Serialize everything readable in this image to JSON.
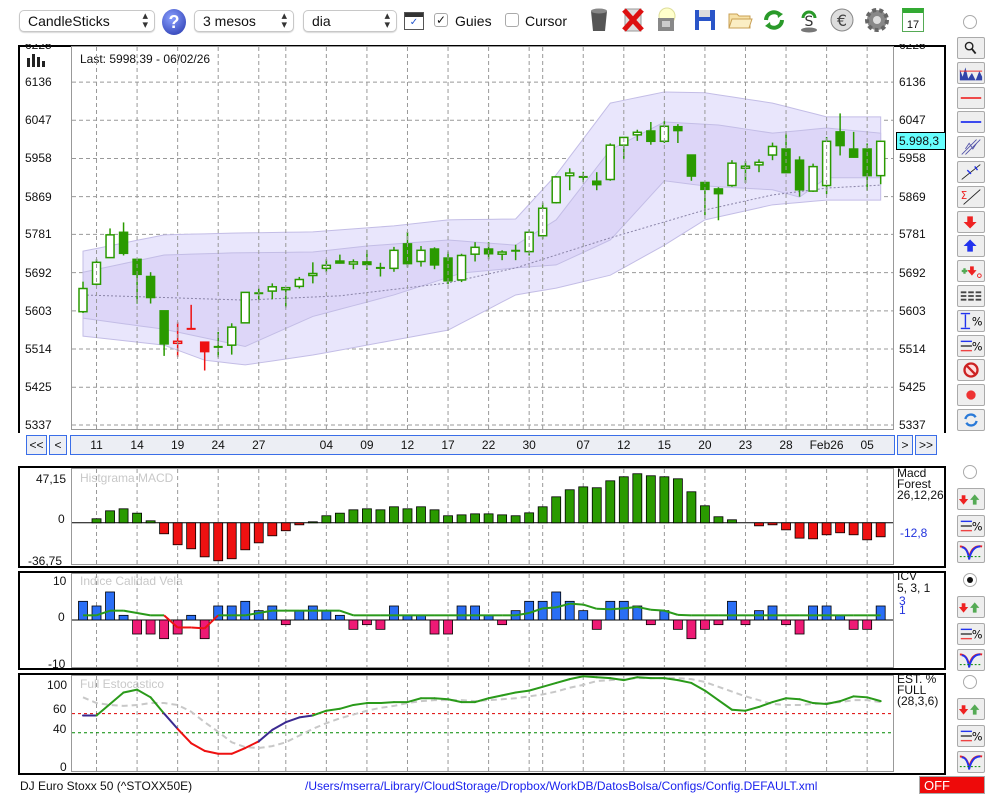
{
  "toolbar": {
    "chart_type": "CandleSticks",
    "period": "3 mesos",
    "interval": "dia",
    "guides_label": "Guies",
    "guides_checked": true,
    "cursor_label": "Cursor",
    "cursor_checked": false,
    "help_icon": "?",
    "calendar_day": "17"
  },
  "main": {
    "last_label": "Last: 5998.39 - 06/02/26",
    "current_price_badge": "5.998,3",
    "badge_color": "#66ffff",
    "y_ticks": [
      "6225",
      "6136",
      "6047",
      "5958",
      "5869",
      "5781",
      "5692",
      "5603",
      "5514",
      "5425",
      "5337"
    ],
    "x_labels": [
      {
        "t": "11",
        "i": 2
      },
      {
        "t": "14",
        "i": 5
      },
      {
        "t": "19",
        "i": 8
      },
      {
        "t": "24",
        "i": 11
      },
      {
        "t": "27",
        "i": 14
      },
      {
        "t": "04",
        "i": 19
      },
      {
        "t": "09",
        "i": 22
      },
      {
        "t": "12",
        "i": 25
      },
      {
        "t": "17",
        "i": 28
      },
      {
        "t": "22",
        "i": 31
      },
      {
        "t": "30",
        "i": 34
      },
      {
        "t": "07",
        "i": 38
      },
      {
        "t": "12",
        "i": 41
      },
      {
        "t": "15",
        "i": 44
      },
      {
        "t": "20",
        "i": 47
      },
      {
        "t": "23",
        "i": 50
      },
      {
        "t": "28",
        "i": 53
      },
      {
        "t": "Feb26",
        "i": 56
      },
      {
        "t": "05",
        "i": 59
      }
    ],
    "grid_candles": [
      2,
      5,
      8,
      11,
      14,
      16,
      19,
      22,
      25,
      28,
      31,
      34,
      35,
      38,
      41,
      44,
      47,
      50,
      53,
      56,
      59
    ],
    "nav": {
      "first": "<<",
      "prev": "<",
      "next": ">",
      "last": ">>"
    }
  },
  "chart_data": [
    {
      "type": "candlestick",
      "title": "DJ Euro Stoxx 50",
      "ylim": [
        5337,
        6225
      ],
      "ohlc": [
        [
          5601,
          5671,
          5598,
          5655
        ],
        [
          5665,
          5723,
          5662,
          5716
        ],
        [
          5727,
          5795,
          5726,
          5780
        ],
        [
          5786,
          5809,
          5732,
          5737
        ],
        [
          5723,
          5723,
          5620,
          5688
        ],
        [
          5683,
          5693,
          5620,
          5634
        ],
        [
          5603,
          5603,
          5498,
          5526
        ],
        [
          5528,
          5576,
          5496,
          5532
        ],
        [
          5561,
          5617,
          5561,
          5561
        ],
        [
          5530,
          5530,
          5464,
          5508
        ],
        [
          5519,
          5554,
          5495,
          5520
        ],
        [
          5523,
          5574,
          5501,
          5565
        ],
        [
          5575,
          5646,
          5575,
          5646
        ],
        [
          5644,
          5655,
          5628,
          5644
        ],
        [
          5649,
          5667,
          5630,
          5659
        ],
        [
          5653,
          5657,
          5611,
          5657
        ],
        [
          5660,
          5682,
          5655,
          5676
        ],
        [
          5688,
          5716,
          5667,
          5690
        ],
        [
          5702,
          5723,
          5693,
          5709
        ],
        [
          5719,
          5734,
          5713,
          5716
        ],
        [
          5712,
          5723,
          5700,
          5717
        ],
        [
          5717,
          5745,
          5698,
          5711
        ],
        [
          5703,
          5715,
          5683,
          5704
        ],
        [
          5702,
          5752,
          5694,
          5744
        ],
        [
          5759,
          5787,
          5704,
          5713
        ],
        [
          5718,
          5754,
          5706,
          5744
        ],
        [
          5747,
          5751,
          5700,
          5710
        ],
        [
          5726,
          5741,
          5665,
          5673
        ],
        [
          5675,
          5736,
          5670,
          5732
        ],
        [
          5735,
          5763,
          5718,
          5751
        ],
        [
          5747,
          5763,
          5723,
          5736
        ],
        [
          5735,
          5744,
          5721,
          5740
        ],
        [
          5743,
          5757,
          5721,
          5744
        ],
        [
          5741,
          5793,
          5732,
          5786
        ],
        [
          5778,
          5855,
          5770,
          5842
        ],
        [
          5855,
          5917,
          5853,
          5915
        ],
        [
          5918,
          5935,
          5884,
          5924
        ],
        [
          5915,
          5927,
          5903,
          5915
        ],
        [
          5905,
          5926,
          5884,
          5897
        ],
        [
          5909,
          5993,
          5906,
          5989
        ],
        [
          5989,
          6007,
          5957,
          6007
        ],
        [
          6013,
          6025,
          5999,
          6019
        ],
        [
          6022,
          6043,
          5990,
          5998
        ],
        [
          5998,
          6045,
          5994,
          6033
        ],
        [
          6032,
          6038,
          5994,
          6023
        ],
        [
          5966,
          5966,
          5906,
          5917
        ],
        [
          5902,
          5902,
          5826,
          5886
        ],
        [
          5887,
          5891,
          5814,
          5876
        ],
        [
          5895,
          5954,
          5892,
          5947
        ],
        [
          5938,
          5952,
          5901,
          5940
        ],
        [
          5943,
          5956,
          5926,
          5949
        ],
        [
          5966,
          5995,
          5954,
          5986
        ],
        [
          5980,
          6016,
          5925,
          5925
        ],
        [
          5954,
          5963,
          5869,
          5885
        ],
        [
          5882,
          5946,
          5880,
          5939
        ],
        [
          5895,
          6008,
          5875,
          5998
        ],
        [
          6020,
          6063,
          5965,
          5988
        ],
        [
          5980,
          6020,
          5960,
          5961
        ],
        [
          5980,
          5993,
          5883,
          5918
        ],
        [
          5918,
          5995,
          5898,
          5998
        ]
      ],
      "red_candles": [
        8,
        9,
        10
      ],
      "up_color": "#2a9a00",
      "alert_color": "#ee1111",
      "bands": {
        "outer_upper": [
          [
            1,
            5742
          ],
          [
            7,
            5780
          ],
          [
            12,
            5784
          ],
          [
            18,
            5787
          ],
          [
            24,
            5801
          ],
          [
            28,
            5815
          ],
          [
            33,
            5817
          ],
          [
            36,
            5920
          ],
          [
            40,
            6087
          ],
          [
            44,
            6113
          ],
          [
            47,
            6111
          ],
          [
            52,
            6087
          ],
          [
            56,
            6055
          ],
          [
            60,
            6055
          ]
        ],
        "inner_upper": [
          [
            1,
            5693
          ],
          [
            7,
            5733
          ],
          [
            12,
            5738
          ],
          [
            18,
            5740
          ],
          [
            22,
            5754
          ],
          [
            28,
            5768
          ],
          [
            33,
            5756
          ],
          [
            36,
            5815
          ],
          [
            40,
            5978
          ],
          [
            44,
            6043
          ],
          [
            48,
            6036
          ],
          [
            52,
            6017
          ],
          [
            56,
            6029
          ],
          [
            60,
            6017
          ]
        ],
        "middle": [
          [
            1,
            5640
          ],
          [
            13,
            5628
          ],
          [
            20,
            5638
          ],
          [
            28,
            5668
          ],
          [
            33,
            5703
          ],
          [
            40,
            5773
          ],
          [
            47,
            5838
          ],
          [
            52,
            5873
          ],
          [
            56,
            5889
          ],
          [
            60,
            5896
          ]
        ],
        "inner_lower": [
          [
            1,
            5586
          ],
          [
            7,
            5560
          ],
          [
            13,
            5520
          ],
          [
            18,
            5590
          ],
          [
            24,
            5640
          ],
          [
            29,
            5691
          ],
          [
            33,
            5703
          ],
          [
            36,
            5710
          ],
          [
            40,
            5768
          ],
          [
            44,
            5906
          ],
          [
            47,
            5894
          ],
          [
            52,
            5885
          ],
          [
            54,
            5868
          ],
          [
            56,
            5913
          ],
          [
            60,
            5913
          ]
        ],
        "outer_lower": [
          [
            1,
            5544
          ],
          [
            7,
            5523
          ],
          [
            10,
            5488
          ],
          [
            13,
            5477
          ],
          [
            18,
            5500
          ],
          [
            22,
            5523
          ],
          [
            28,
            5558
          ],
          [
            33,
            5640
          ],
          [
            36,
            5656
          ],
          [
            40,
            5686
          ],
          [
            44,
            5756
          ],
          [
            47,
            5815
          ],
          [
            52,
            5850
          ],
          [
            56,
            5861
          ],
          [
            60,
            5861
          ]
        ]
      }
    },
    {
      "type": "bar",
      "title": "Histgrama MACD",
      "ylim": [
        -36.75,
        47.15
      ],
      "y_ticks": [
        "47,15",
        "0",
        "-36,75"
      ],
      "legend": [
        "Macd",
        "Forest",
        "26,12,26"
      ],
      "last_value": "-12,8",
      "values": [
        0,
        3.6,
        10.7,
        12.5,
        8.6,
        1.8,
        -9.8,
        -19.6,
        -23.2,
        -30.4,
        -33.9,
        -32.1,
        -24.1,
        -17.9,
        -11.6,
        -7.1,
        -1.8,
        0.9,
        6.3,
        8.6,
        11.6,
        12.5,
        11.6,
        14.3,
        12.5,
        14.3,
        11.6,
        6.3,
        7.1,
        8.0,
        8.0,
        7.1,
        6.3,
        8.9,
        14.3,
        23.2,
        29.5,
        32.1,
        31.3,
        37.5,
        41.1,
        43.8,
        42.0,
        41.1,
        39.3,
        27.7,
        15.2,
        5.4,
        2.7,
        0,
        -2.7,
        -1.8,
        -6.3,
        -13.7,
        -14.3,
        -10.7,
        -8.9,
        -10.7,
        -15.2,
        -12.5
      ],
      "pos_color": "#2a9a00",
      "neg_color": "#ee1111"
    },
    {
      "type": "bar",
      "title": "Indice Calidad Vela",
      "ylim": [
        -10,
        10
      ],
      "y_ticks": [
        "10",
        "0",
        "-10"
      ],
      "legend": [
        "ICV",
        "5, 3, 1"
      ],
      "legend_values": [
        "3",
        "1"
      ],
      "values": [
        4,
        3,
        6,
        1,
        -3,
        -3,
        -4,
        -3,
        1,
        -4,
        3,
        3,
        4,
        2,
        3,
        -1,
        2,
        3,
        2,
        1,
        -2,
        -1,
        -2,
        3,
        1,
        1,
        -3,
        -3,
        3,
        3,
        1,
        -1,
        2,
        4,
        4,
        6,
        4,
        2,
        -2,
        4,
        4,
        3,
        -1,
        2,
        -2,
        -4,
        -2,
        -1,
        4,
        -1,
        2,
        3,
        -1,
        -3,
        3,
        3,
        1,
        -2,
        -2,
        3
      ],
      "signal": [
        1,
        1,
        2,
        2,
        1.5,
        1,
        1,
        -1.6,
        -1.6,
        -1.8,
        1,
        1,
        1,
        1.5,
        2,
        2,
        2,
        2,
        2,
        2,
        1,
        1,
        1,
        1,
        1,
        1,
        1,
        1,
        1,
        1,
        1,
        1,
        1,
        1.5,
        2.5,
        2.7,
        3.5,
        3.3,
        2.4,
        2.3,
        2.5,
        2.8,
        2.2,
        2,
        1.1,
        1,
        1,
        1,
        1,
        1,
        1,
        1,
        1,
        1,
        1,
        1,
        1,
        1,
        1,
        1
      ],
      "pos_color": "#2a6ef5",
      "neg_color": "#ee1a75"
    },
    {
      "type": "line",
      "title": "Full Estocastico",
      "ylim": [
        0,
        100
      ],
      "y_ticks": [
        "100",
        "60",
        "40",
        "0"
      ],
      "levels": [
        60,
        40
      ],
      "legend": [
        "EST. %",
        "FULL",
        "(28,3,6)"
      ],
      "k": [
        58,
        58,
        70,
        82,
        85,
        77,
        60,
        44,
        29,
        21,
        18,
        18,
        24,
        31,
        43,
        51,
        56,
        58,
        63,
        65,
        69,
        71,
        71,
        72,
        72,
        76,
        76,
        75,
        72,
        72,
        76,
        79,
        82,
        84,
        88,
        92,
        96,
        99,
        98,
        97,
        95,
        98,
        97,
        97,
        95,
        92,
        84,
        74,
        64,
        63,
        67,
        72,
        76,
        75,
        71,
        70,
        73,
        78,
        77,
        73
      ],
      "k_colors": "pgggggprrrrrrppppggggggggggggggggggggggggggggggggggggggggggg",
      "d": [
        77,
        71,
        69,
        68,
        69,
        71,
        71,
        69,
        62,
        51,
        41,
        30,
        25,
        24,
        26,
        30,
        37,
        44,
        50,
        55,
        59,
        63,
        66,
        68,
        71,
        73,
        74,
        74,
        74,
        73,
        74,
        75,
        76,
        78,
        80,
        83,
        87,
        90,
        94,
        95,
        96,
        97,
        97,
        97,
        97,
        96,
        93,
        88,
        83,
        78,
        74,
        70,
        69,
        69,
        70,
        71,
        72,
        74,
        74,
        72
      ]
    }
  ],
  "right_tools": [
    "magnifier-icon",
    "volume-chart-icon",
    "red-line-icon",
    "blue-line-icon",
    "channel-icon",
    "trendline-icon",
    "sigma-trendline-icon",
    "red-down-arrow-icon",
    "blue-up-arrow-icon",
    "add-alert-icon",
    "dashed-lines-icon",
    "percent-range-icon",
    "percent-lines-icon",
    "no-entry-icon",
    "red-dot-icon",
    "refresh-icon"
  ],
  "panel_tools": [
    "alert-arrows-icon",
    "percent-lines-icon",
    "curve-icon"
  ],
  "footer": {
    "instrument": "DJ Euro Stoxx 50 (^STOXX50E)",
    "config_path": "/Users/mserra/Library/CloudStorage/Dropbox/WorkDB/DatosBolsa/Configs/Config.DEFAULT.xml",
    "status": "OFF"
  }
}
